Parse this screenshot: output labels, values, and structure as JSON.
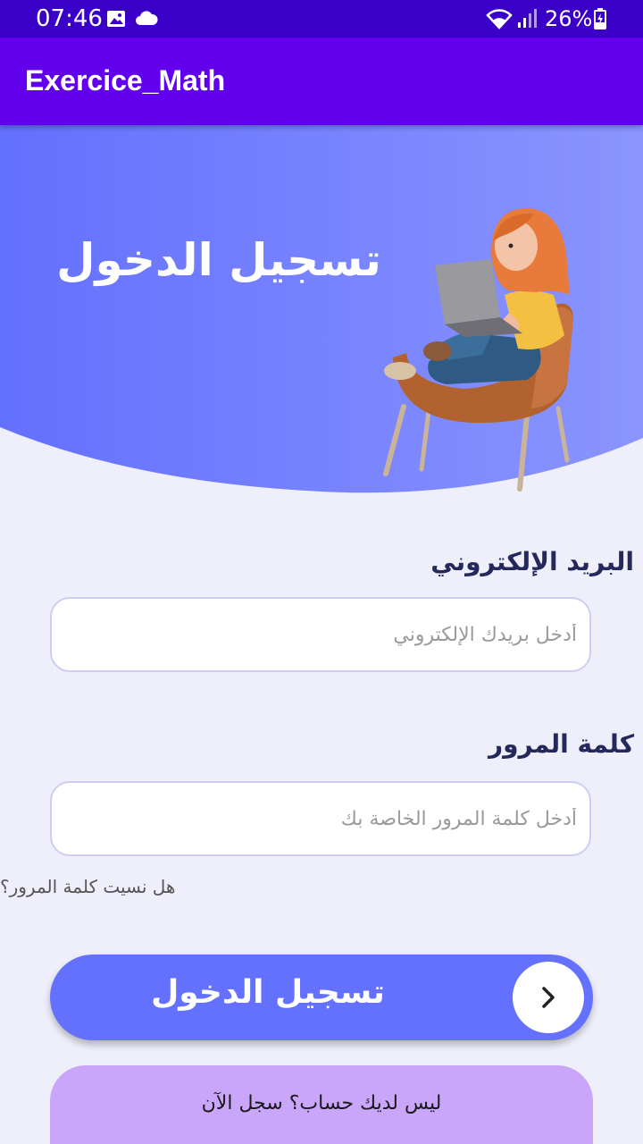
{
  "status_bar": {
    "time": "07:46",
    "battery": "26%",
    "icons": [
      "image-icon",
      "cloud-icon",
      "wifi-icon",
      "signal-icon",
      "battery-charging-icon"
    ]
  },
  "app_bar": {
    "title": "Exercice_Math"
  },
  "hero": {
    "title": "تسجيل الدخول",
    "illustration": "person-with-laptop-in-chair"
  },
  "form": {
    "email_label": "البريد الإلكتروني",
    "email_placeholder": "أدخل بريدك الإلكتروني",
    "password_label": "كلمة المرور",
    "password_placeholder": "أدخل كلمة المرور الخاصة بك",
    "forgot_password": "هل نسيت كلمة المرور؟"
  },
  "actions": {
    "login_label": "تسجيل الدخول",
    "register_label": "ليس لديك حساب؟ سجل الآن"
  },
  "colors": {
    "status_bar": "#3A00C8",
    "app_bar": "#6200EE",
    "hero_gradient_start": "#6470FE",
    "hero_gradient_end": "#8A95FE",
    "background": "#EEEFFA",
    "login_button": "#6471FF",
    "register_button": "#C9A6FA",
    "label_text": "#24285A"
  }
}
